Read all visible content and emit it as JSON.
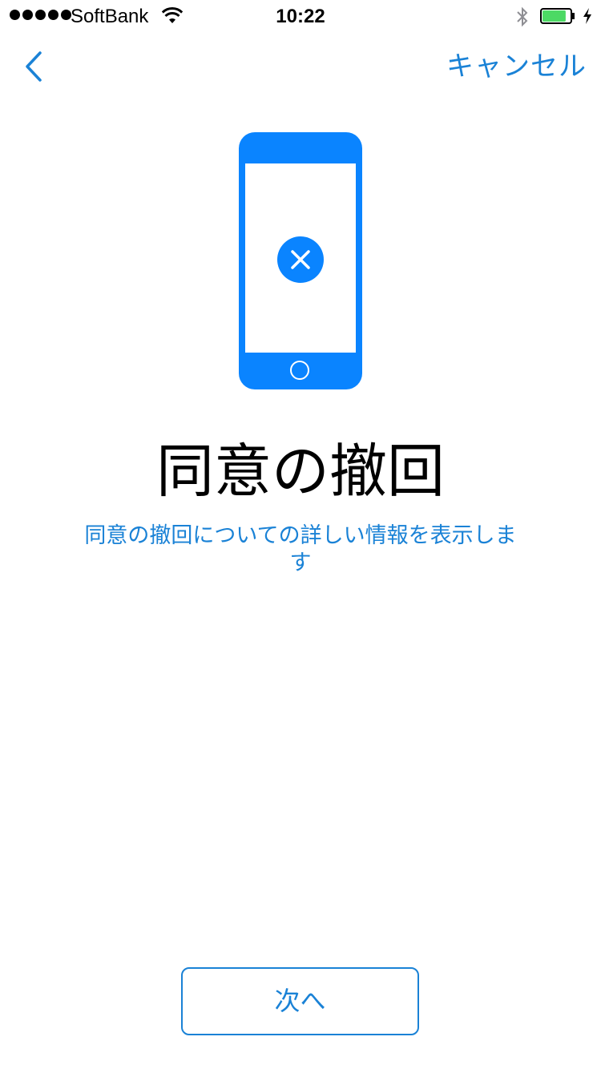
{
  "status_bar": {
    "carrier": "SoftBank",
    "time": "10:22",
    "signal_icon": "signal-dots-icon",
    "wifi_icon": "wifi-icon",
    "bluetooth_icon": "bluetooth-icon",
    "battery_icon": "battery-icon",
    "battery_level": 0.85,
    "charging_icon": "charging-bolt-icon"
  },
  "nav": {
    "back_icon": "chevron-left-icon",
    "cancel_label": "キャンセル"
  },
  "illustration": {
    "icon": "phone-with-x-icon"
  },
  "content": {
    "title": "同意の撤回",
    "info_link": "同意の撤回についての詳しい情報を表示します"
  },
  "footer": {
    "next_label": "次へ"
  },
  "colors": {
    "accent": "#1a82d6",
    "phone_blue": "#0a84ff",
    "battery_green": "#4cd964"
  }
}
